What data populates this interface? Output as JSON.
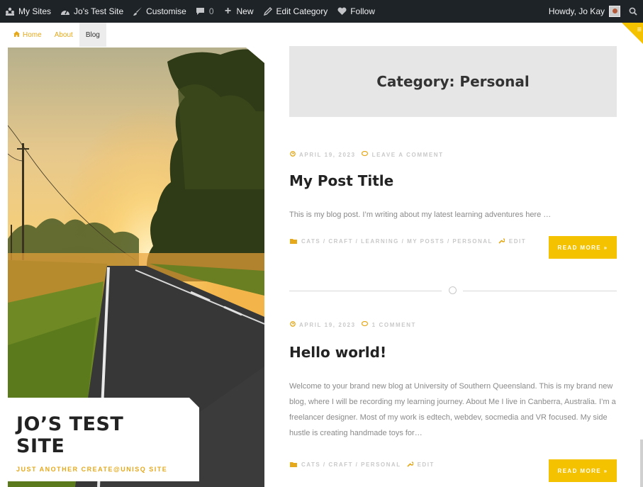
{
  "adminbar": {
    "items": [
      {
        "icon": "network-icon",
        "label": "My Sites"
      },
      {
        "icon": "dashboard-icon",
        "label": "Jo's Test Site"
      },
      {
        "icon": "brush-icon",
        "label": "Customise"
      },
      {
        "icon": "comment-icon",
        "label": "0"
      },
      {
        "icon": "plus-icon",
        "label": "New"
      },
      {
        "icon": "pencil-icon",
        "label": "Edit Category"
      },
      {
        "icon": "heart-icon",
        "label": "Follow"
      }
    ],
    "howdy": "Howdy, Jo Kay"
  },
  "nav": {
    "home": "Home",
    "about": "About",
    "blog": "Blog"
  },
  "site": {
    "title": "JO’S TEST SITE",
    "title_line1": "JO’S TEST",
    "title_line2": "SITE",
    "tagline": "JUST ANOTHER CREATE@UNISQ SITE"
  },
  "category": {
    "title": "Category: Personal"
  },
  "posts": [
    {
      "date": "APRIL 19, 2023",
      "comments": "LEAVE A COMMENT",
      "title": "My Post Title",
      "excerpt": "This is my blog post. I’m writing about my latest learning adventures here …",
      "tags": "CATS / CRAFT / LEARNING / MY POSTS / PERSONAL",
      "edit": "EDIT",
      "read_more": "READ MORE  »"
    },
    {
      "date": "APRIL 19, 2023",
      "comments": "1 COMMENT",
      "title": "Hello world!",
      "excerpt": "Welcome to your brand new blog at University of Southern Queensland. This is my brand new blog, where I will be recording my learning journey. About Me I live in Canberra, Australia. I’m a freelancer designer. Most of my work is edtech, webdev, socmedia and VR focused. My side hustle is creating handmade toys for…",
      "tags": "CATS / CRAFT / PERSONAL",
      "edit": "EDIT",
      "read_more": "READ MORE  »"
    }
  ],
  "colors": {
    "accent": "#f5c200",
    "link": "#e5a91b",
    "adminbar": "#1d2327"
  }
}
